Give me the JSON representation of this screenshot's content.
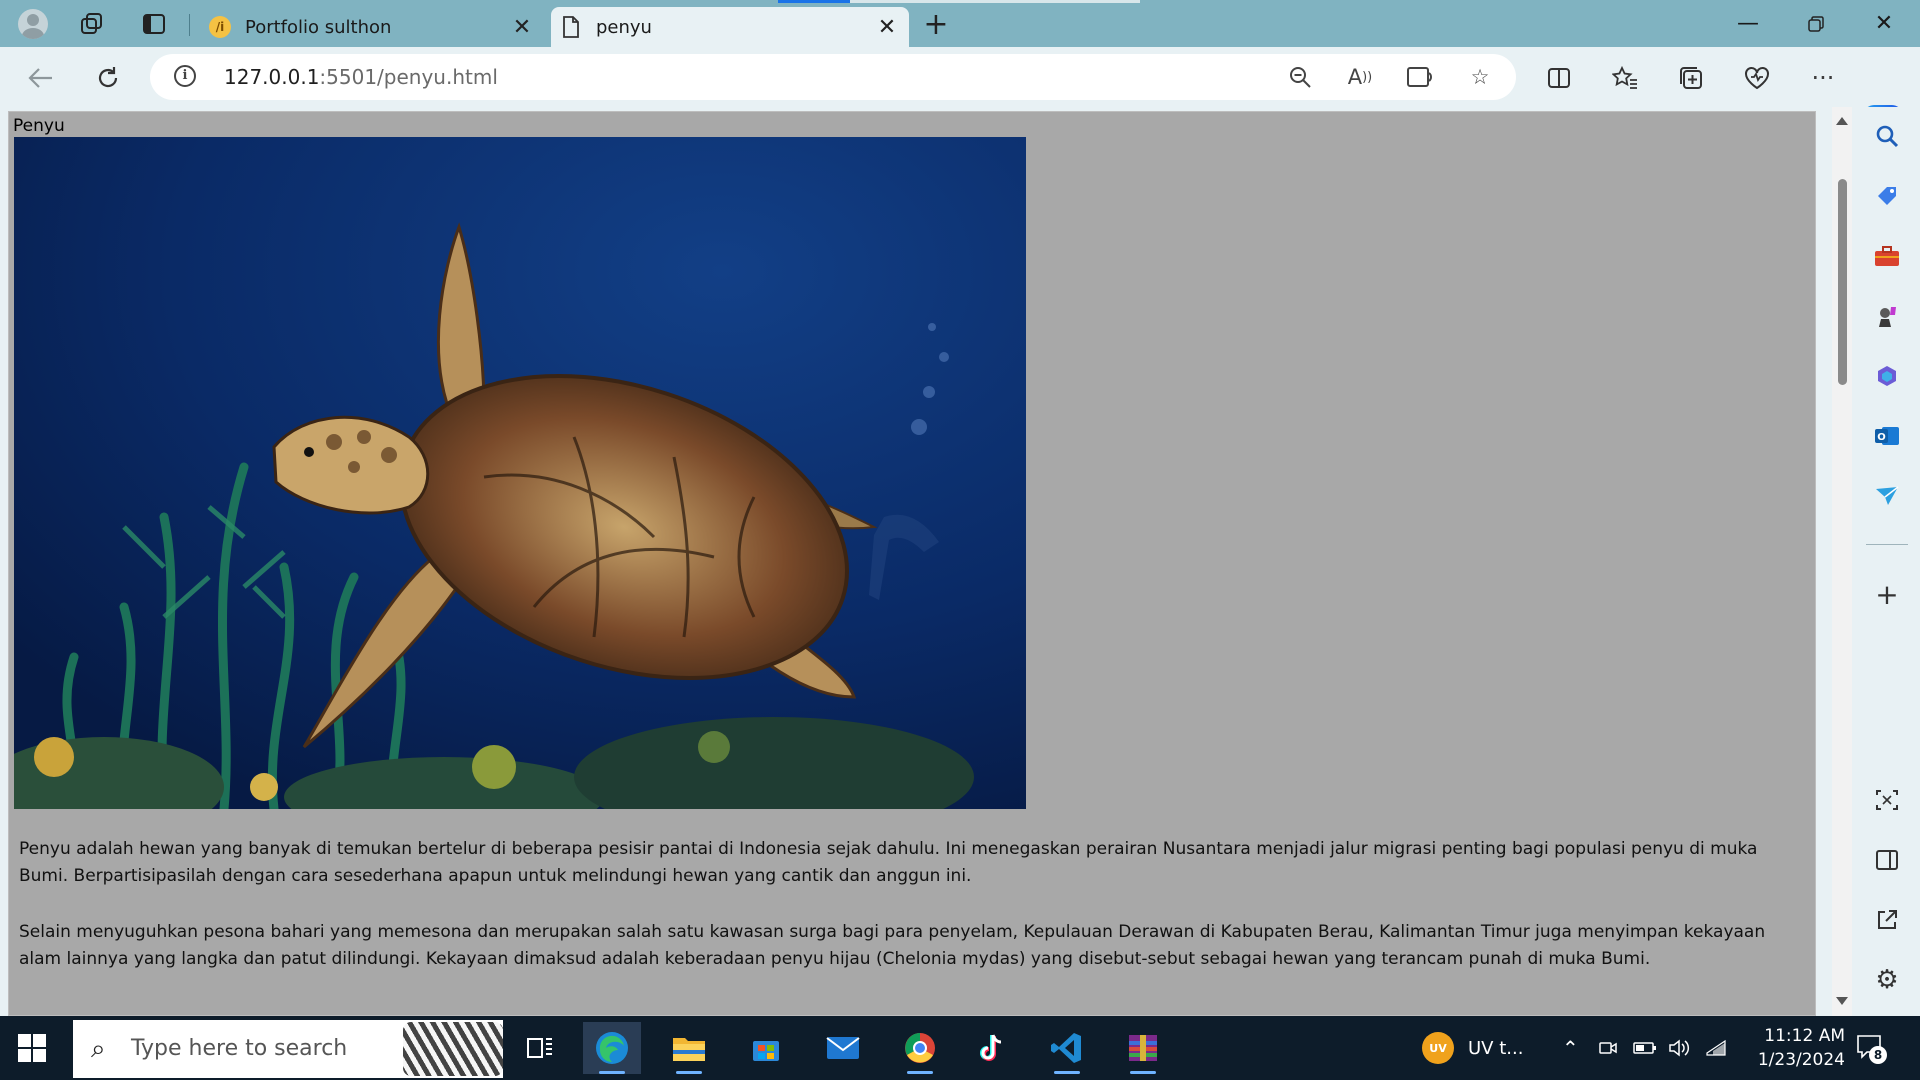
{
  "browser": {
    "tabs": [
      {
        "title": "Portfolio sulthon",
        "active": false
      },
      {
        "title": "penyu",
        "active": true
      }
    ],
    "url_host": "127.0.0.1",
    "url_rest": ":5501/penyu.html"
  },
  "page": {
    "heading": "Penyu",
    "image_alt": "sea-turtle-photo",
    "paragraphs": [
      "Penyu adalah hewan yang banyak di temukan bertelur di beberapa pesisir pantai di Indonesia sejak dahulu. Ini menegaskan perairan Nusantara menjadi jalur migrasi penting bagi populasi penyu di muka Bumi. Berpartisipasilah dengan cara sesederhana apapun untuk melindungi hewan yang cantik dan anggun ini.",
      "Selain menyuguhkan pesona bahari yang memesona dan merupakan salah satu kawasan surga bagi para penyelam, Kepulauan Derawan di Kabupaten Berau, Kalimantan Timur juga menyimpan kekayaan alam lainnya yang langka dan patut dilindungi. Kekayaan dimaksud adalah keberadaan penyu hijau (Chelonia mydas) yang disebut-sebut sebagai hewan yang terancam punah di muka Bumi."
    ]
  },
  "taskbar": {
    "search_placeholder": "Type here to search",
    "weather_label": "UV t...",
    "uv_badge": "UV",
    "time": "11:12 AM",
    "date": "1/23/2024",
    "notification_count": "8"
  }
}
